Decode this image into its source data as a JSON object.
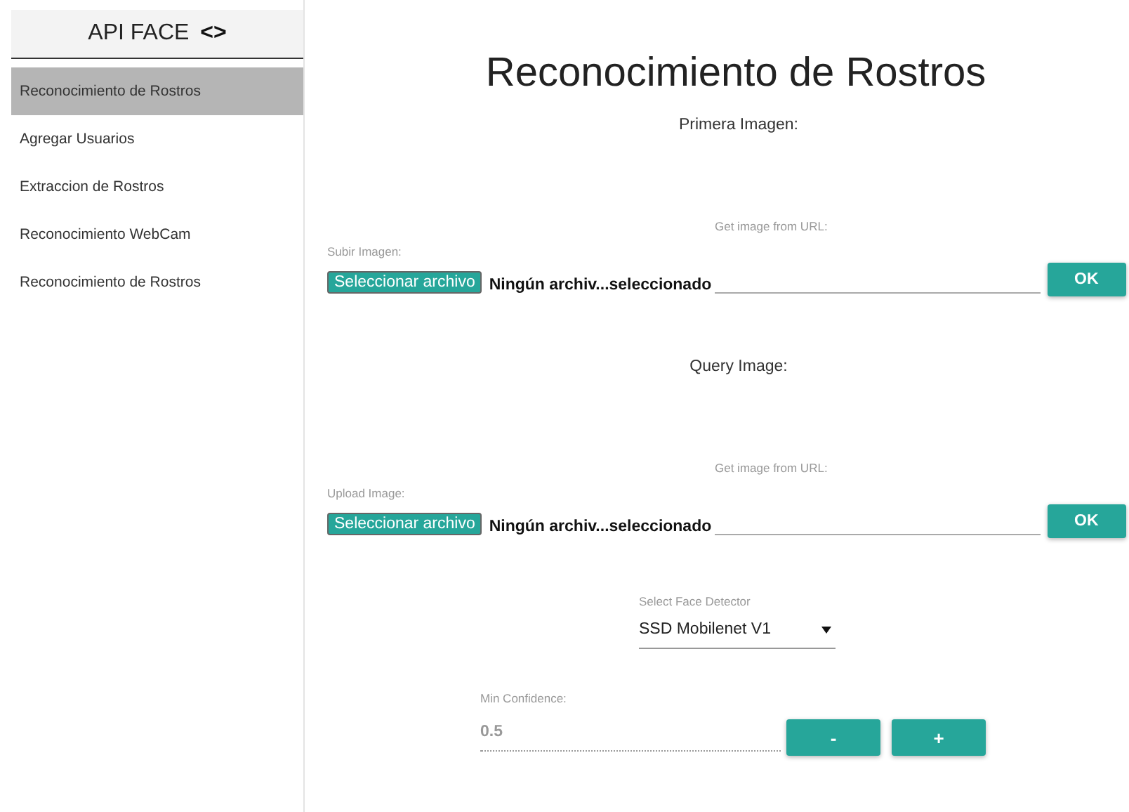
{
  "sidebar": {
    "title": "API FACE",
    "toggle_icon": "<>",
    "items": [
      {
        "label": "Reconocimiento de Rostros",
        "selected": true
      },
      {
        "label": "Agregar Usuarios",
        "selected": false
      },
      {
        "label": "Extraccion de Rostros",
        "selected": false
      },
      {
        "label": "Reconocimiento WebCam",
        "selected": false
      },
      {
        "label": "Reconocimiento de Rostros",
        "selected": false
      }
    ]
  },
  "main": {
    "title": "Reconocimiento de Rostros",
    "image_sections": [
      {
        "heading": "Primera Imagen:",
        "url_label": "Get image from URL:",
        "upload_label": "Subir Imagen:",
        "file_button": "Seleccionar archivo",
        "file_status": "Ningún archiv...seleccionado",
        "ok_button": "OK"
      },
      {
        "heading": "Query Image:",
        "url_label": "Get image from URL:",
        "upload_label": "Upload Image:",
        "file_button": "Seleccionar archivo",
        "file_status": "Ningún archiv...seleccionado",
        "ok_button": "OK"
      }
    ],
    "detector": {
      "label": "Select Face Detector",
      "value": "SSD Mobilenet V1"
    },
    "confidence": {
      "label": "Min Confidence:",
      "value": "0.5",
      "minus_button": "-",
      "plus_button": "+"
    }
  }
}
